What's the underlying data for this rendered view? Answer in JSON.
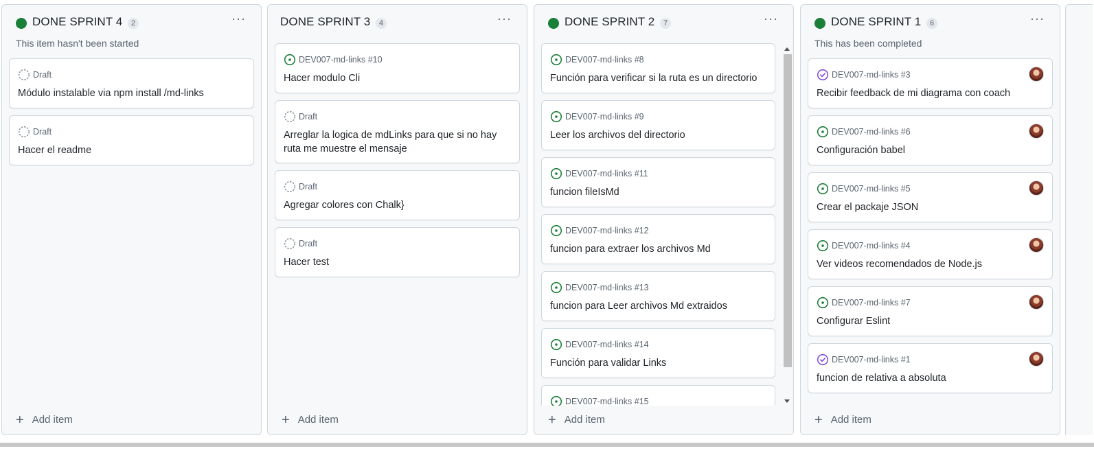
{
  "colors": {
    "done_green": "#1a7f37",
    "draft_gray": "#8c959f",
    "closed_purple": "#8250df"
  },
  "columns": [
    {
      "title": "DONE SPRINT 4",
      "count": "2",
      "show_dot": true,
      "description": "This item hasn't been started",
      "menu_label": "···",
      "add_item": "Add item",
      "cards": [
        {
          "kind": "draft",
          "ref": "Draft",
          "title": "Módulo instalable via npm install /md-links"
        },
        {
          "kind": "draft",
          "ref": "Draft",
          "title": "Hacer el readme"
        }
      ]
    },
    {
      "title": "DONE SPRINT 3",
      "count": "4",
      "show_dot": false,
      "description": "",
      "menu_label": "···",
      "add_item": "Add item",
      "cards": [
        {
          "kind": "open",
          "ref": "DEV007-md-links #10",
          "title": "Hacer modulo Cli"
        },
        {
          "kind": "draft",
          "ref": "Draft",
          "title": "Arreglar la logica de mdLinks para que si no hay ruta me muestre el mensaje"
        },
        {
          "kind": "draft",
          "ref": "Draft",
          "title": "Agregar colores con Chalk}"
        },
        {
          "kind": "draft",
          "ref": "Draft",
          "title": "Hacer test"
        }
      ]
    },
    {
      "title": "DONE SPRINT 2",
      "count": "7",
      "show_dot": true,
      "description": "",
      "menu_label": "···",
      "add_item": "Add item",
      "cards": [
        {
          "kind": "open",
          "ref": "DEV007-md-links #8",
          "title": "Función para verificar si la ruta es un directorio"
        },
        {
          "kind": "open",
          "ref": "DEV007-md-links #9",
          "title": "Leer los archivos del directorio"
        },
        {
          "kind": "open",
          "ref": "DEV007-md-links #11",
          "title": "funcion fileIsMd"
        },
        {
          "kind": "open",
          "ref": "DEV007-md-links #12",
          "title": "funcion para extraer los archivos Md"
        },
        {
          "kind": "open",
          "ref": "DEV007-md-links #13",
          "title": "funcion para Leer archivos Md extraidos"
        },
        {
          "kind": "open",
          "ref": "DEV007-md-links #14",
          "title": "Función para validar Links"
        },
        {
          "kind": "open",
          "ref": "DEV007-md-links #15",
          "title": ""
        }
      ]
    },
    {
      "title": "DONE SPRINT 1",
      "count": "6",
      "show_dot": true,
      "description": "This has been completed",
      "menu_label": "···",
      "add_item": "Add item",
      "cards": [
        {
          "kind": "closed",
          "ref": "DEV007-md-links #3",
          "title": "Recibir feedback de mi diagrama con coach",
          "avatar": true
        },
        {
          "kind": "open",
          "ref": "DEV007-md-links #6",
          "title": "Configuración babel",
          "avatar": true
        },
        {
          "kind": "open",
          "ref": "DEV007-md-links #5",
          "title": "Crear el packaje JSON",
          "avatar": true
        },
        {
          "kind": "open",
          "ref": "DEV007-md-links #4",
          "title": "Ver videos recomendados de Node.js",
          "avatar": true
        },
        {
          "kind": "open",
          "ref": "DEV007-md-links #7",
          "title": "Configurar Eslint",
          "avatar": true
        },
        {
          "kind": "closed",
          "ref": "DEV007-md-links #1",
          "title": "funcion de relativa a absoluta",
          "avatar": true
        }
      ]
    }
  ]
}
